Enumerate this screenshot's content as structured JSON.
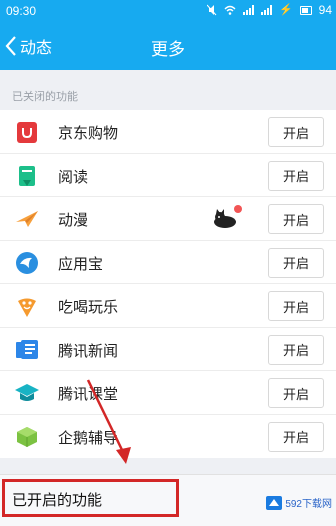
{
  "status_bar": {
    "time": "09:30",
    "battery": "94"
  },
  "header": {
    "back_label": "动态",
    "title": "更多"
  },
  "section": {
    "disabled_title": "已关闭的功能"
  },
  "features": [
    {
      "name": "京东购物",
      "button": "开启",
      "icon": "jd-shopping-icon"
    },
    {
      "name": "阅读",
      "button": "开启",
      "icon": "reading-icon"
    },
    {
      "name": "动漫",
      "button": "开启",
      "icon": "anime-icon"
    },
    {
      "name": "应用宝",
      "button": "开启",
      "icon": "app-store-icon"
    },
    {
      "name": "吃喝玩乐",
      "button": "开启",
      "icon": "food-fun-icon"
    },
    {
      "name": "腾讯新闻",
      "button": "开启",
      "icon": "tencent-news-icon"
    },
    {
      "name": "腾讯课堂",
      "button": "开启",
      "icon": "tencent-classroom-icon"
    },
    {
      "name": "企鹅辅导",
      "button": "开启",
      "icon": "penguin-tutoring-icon"
    }
  ],
  "enabled_section": {
    "title": "已开启的功能"
  },
  "watermark": {
    "text": "592下载网"
  },
  "colors": {
    "header_blue": "#17aaf0",
    "annotation_red": "#d32727",
    "jd_red": "#e4393c",
    "reading_green": "#1dbf8a",
    "anime_orange": "#f7a03c",
    "appstore_blue": "#2a8fe0",
    "food_orange": "#f59a2e",
    "news_blue": "#2d86e8",
    "classroom_teal": "#18b3c4",
    "tutor_green": "#7cc242"
  }
}
